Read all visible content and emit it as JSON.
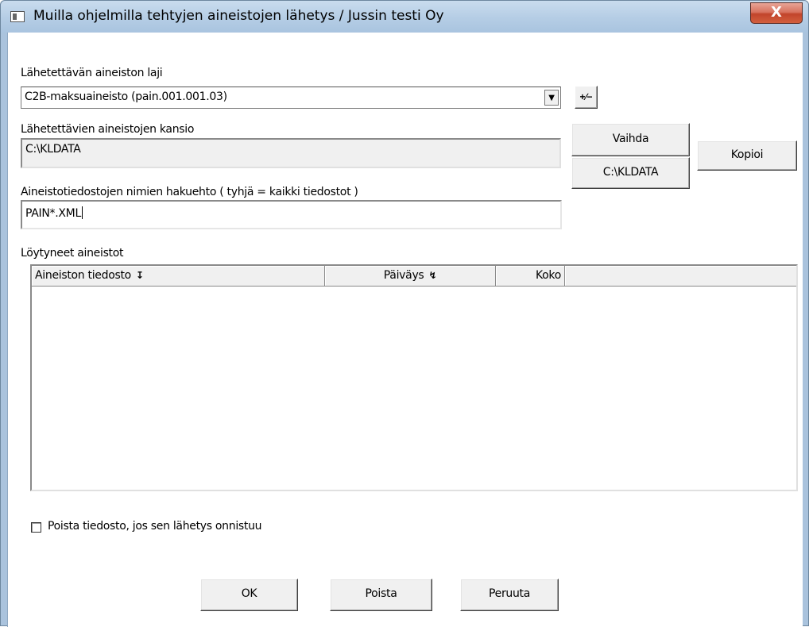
{
  "window": {
    "title": "Muilla ohjelmilla tehtyjen aineistojen lähetys / Jussin testi Oy",
    "close_label": "X"
  },
  "type_section": {
    "label": "Lähetettävän aineiston laji",
    "selected_value": "C2B-maksuaineisto (pain.001.001.03)",
    "arrow_glyph": "▼",
    "plusminus_glyph": "+∕−"
  },
  "folder_section": {
    "label": "Lähetettävien aineistojen kansio",
    "value": "C:\\KLDATA",
    "change_button": "Vaihda",
    "default_button": "C:\\KLDATA",
    "copy_button": "Kopioi"
  },
  "filter_section": {
    "label": "Aineistotiedostojen nimien hakuehto ( tyhjä = kaikki tiedostot )",
    "value": "PAIN*.XML"
  },
  "results": {
    "label": "Löytyneet aineistot",
    "columns": [
      "Aineiston tiedosto",
      "Päiväys",
      "Koko",
      ""
    ],
    "rows": []
  },
  "delete_option": {
    "label": "Poista tiedosto, jos sen lähetys onnistuu",
    "checked": false
  },
  "buttons": {
    "ok": "OK",
    "delete": "Poista",
    "cancel": "Peruuta"
  },
  "colors": {
    "titlebar": "#b5cde5",
    "close_button": "#c2442b",
    "dialog_background": "#ffffff",
    "button_face": "#f0f0f0"
  }
}
